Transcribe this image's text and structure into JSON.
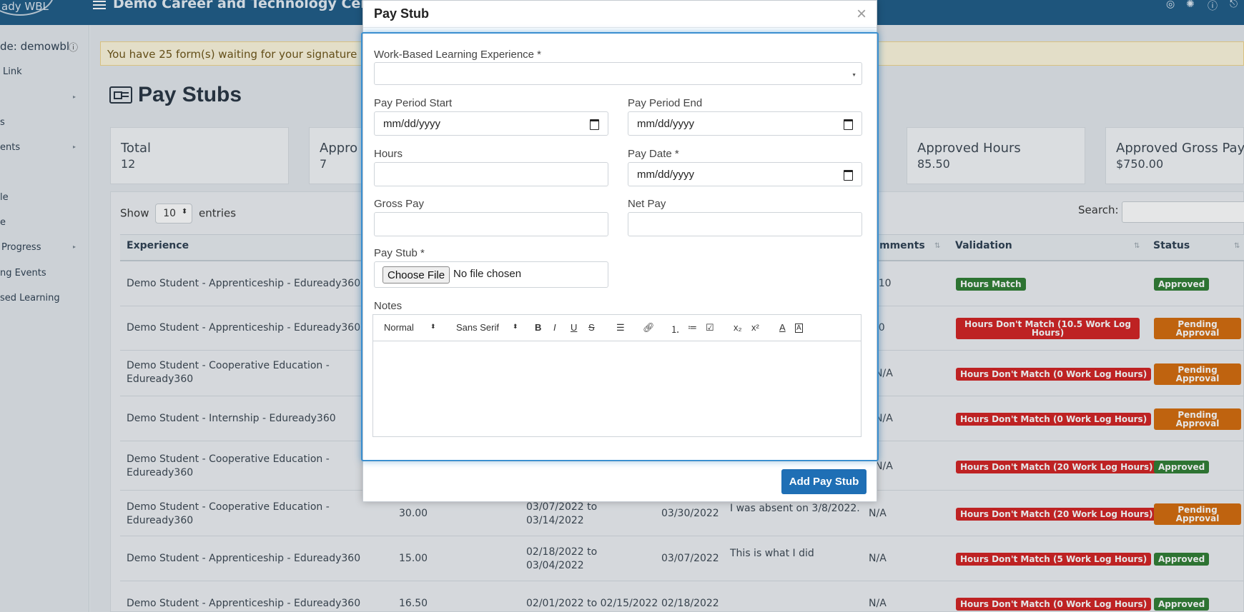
{
  "topbar": {
    "logo_text": "ady WBL",
    "org_name": "Demo Career and Technology Center",
    "icons": [
      "user-icon",
      "settings-icon",
      "help-icon",
      "signout-icon"
    ]
  },
  "sidebar": {
    "user_code": "de: demowbl",
    "items": [
      "Link",
      "",
      "s",
      "ents",
      "le",
      "e",
      "Progress",
      "ng Events",
      "sed Learning"
    ]
  },
  "alert": {
    "text": "You have 25 form(s) waiting for your signature"
  },
  "page": {
    "title": "Pay Stubs"
  },
  "stats": [
    {
      "label": "Total",
      "value": "12"
    },
    {
      "label": "Appro",
      "value": "7"
    },
    {
      "label": "Approved Hours",
      "value": "85.50"
    },
    {
      "label": "Approved Gross Pay",
      "value": "$750.00"
    }
  ],
  "table_controls": {
    "show": "Show",
    "entries_value": "10",
    "entries": "entries",
    "search": "Search:"
  },
  "table": {
    "headers": [
      "Experience",
      "mments",
      "Validation",
      "Status"
    ],
    "rows": [
      {
        "experience": "Demo Student - Apprenticeship - Eduready360",
        "hours": "",
        "period": "",
        "pay_date": "",
        "notes": "",
        "comments": "/10",
        "validation": "Hours Match",
        "validation_color": "green",
        "status": "Approved",
        "status_color": "green"
      },
      {
        "experience": "Demo Student - Apprenticeship - Eduready360",
        "hours": "",
        "period": "",
        "pay_date": "",
        "notes": "",
        "comments": "/0",
        "validation": "Hours Don't Match (10.5 Work Log Hours)",
        "validation_color": "red",
        "status": "Pending Approval",
        "status_color": "orange"
      },
      {
        "experience": "Demo Student - Cooperative Education - Eduready360",
        "hours": "",
        "period": "",
        "pay_date": "",
        "notes": "",
        "comments": "N/A",
        "validation": "Hours Don't Match (0 Work Log Hours)",
        "validation_color": "red",
        "status": "Pending Approval",
        "status_color": "orange"
      },
      {
        "experience": "Demo Student - Internship - Eduready360",
        "hours": "",
        "period": "",
        "pay_date": "",
        "notes": "",
        "comments": "N/A",
        "validation": "Hours Don't Match (0 Work Log Hours)",
        "validation_color": "red",
        "status": "Pending Approval",
        "status_color": "orange"
      },
      {
        "experience": "Demo Student - Cooperative Education - Eduready360",
        "hours": "",
        "period": "",
        "pay_date": "",
        "notes": "",
        "comments": "N/A",
        "validation": "Hours Don't Match (20 Work Log Hours)",
        "validation_color": "red",
        "status": "Approved",
        "status_color": "green"
      },
      {
        "experience": "Demo Student - Cooperative Education - Eduready360",
        "hours": "30.00",
        "period": "03/07/2022 to 03/14/2022",
        "pay_date": "03/30/2022",
        "notes": "I was absent on 3/8/2022.",
        "comments": "N/A",
        "validation": "Hours Don't Match (20 Work Log Hours)",
        "validation_color": "red",
        "status": "Pending Approval",
        "status_color": "orange"
      },
      {
        "experience": "Demo Student - Apprenticeship - Eduready360",
        "hours": "15.00",
        "period": "02/18/2022 to 03/04/2022",
        "pay_date": "03/07/2022",
        "notes": "This is what I did",
        "comments": "N/A",
        "validation": "Hours Don't Match (5 Work Log Hours)",
        "validation_color": "red",
        "status": "Approved",
        "status_color": "green"
      },
      {
        "experience": "Demo Student - Apprenticeship - Eduready360",
        "hours": "16.50",
        "period": "02/01/2022 to 02/15/2022",
        "pay_date": "02/18/2022",
        "notes": "",
        "comments": "N/A",
        "validation": "Hours Don't Match (0 Work Log Hours)",
        "validation_color": "red",
        "status": "Approved",
        "status_color": "green"
      }
    ]
  },
  "modal": {
    "title": "Pay Stub",
    "close": "×",
    "fields": {
      "experience_label": "Work-Based Learning Experience *",
      "experience_value": "",
      "period_start_label": "Pay Period Start",
      "period_start_value": "mm/dd/yyyy",
      "period_end_label": "Pay Period End",
      "period_end_value": "mm/dd/yyyy",
      "hours_label": "Hours",
      "hours_value": "",
      "pay_date_label": "Pay Date *",
      "pay_date_value": "mm/dd/yyyy",
      "gross_pay_label": "Gross Pay",
      "gross_pay_value": "",
      "net_pay_label": "Net Pay",
      "net_pay_value": "",
      "pay_stub_label": "Pay Stub *",
      "choose_file": "Choose File",
      "no_file": "No file chosen",
      "notes_label": "Notes"
    },
    "editor_toolbar": {
      "heading": "Normal",
      "font": "Sans Serif",
      "buttons": [
        "bold-icon",
        "italic-icon",
        "underline-icon",
        "strike-icon",
        "align-icon",
        "link-icon",
        "ordered-list-icon",
        "bullet-list-icon",
        "check-list-icon",
        "subscript-icon",
        "superscript-icon",
        "text-color-icon",
        "background-color-icon"
      ]
    },
    "submit": "Add Pay Stub"
  },
  "colors": {
    "topbar": "#1d5a86",
    "primary_button": "#1f6fb5",
    "badge_green": "#2e7d32",
    "badge_red": "#d32020",
    "badge_orange": "#d46a0a",
    "focus_border": "#3a8fd0"
  }
}
